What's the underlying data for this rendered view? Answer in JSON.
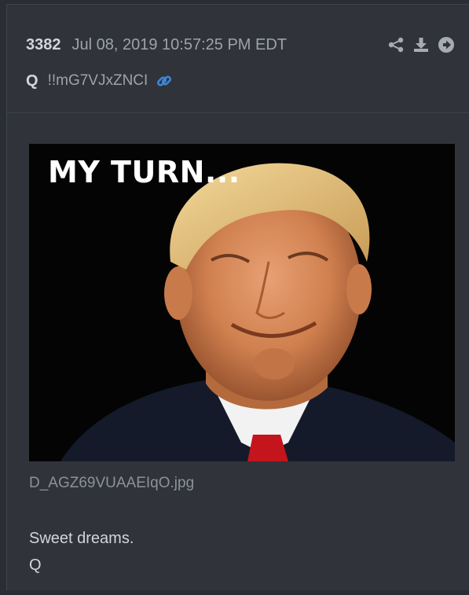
{
  "post": {
    "number": "3382",
    "timestamp": "Jul 08, 2019 10:57:25 PM EDT",
    "author": "Q",
    "tripcode": "!!mG7VJxZNCI",
    "actions": {
      "share_icon": "share-icon",
      "download_icon": "download-icon",
      "go_icon": "arrow-right-circle-icon"
    },
    "link_icon": "link-icon",
    "image": {
      "caption": "MY TURN...",
      "filename": "D_AGZ69VUAAEIqO.jpg"
    },
    "message": [
      "Sweet dreams.",
      "Q"
    ]
  },
  "colors": {
    "page_bg": "#2a2d33",
    "post_bg": "#30333a",
    "text": "#d3d5d9",
    "muted": "#9ea2aa",
    "icon": "#a7abb3",
    "link_icon": "#3f86d6"
  }
}
